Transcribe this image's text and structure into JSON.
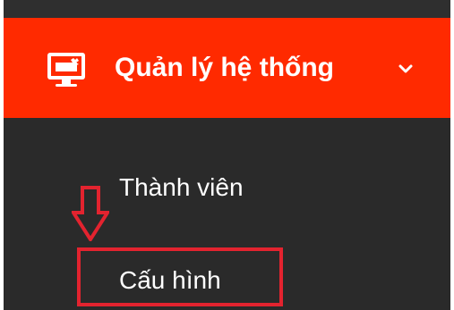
{
  "colors": {
    "header_bg": "#ff2a00",
    "sidebar_bg": "#2a2a2a",
    "text": "#ffffff",
    "annotation": "#e3232f"
  },
  "menu": {
    "header": {
      "label": "Quản lý hệ thống",
      "icon": "monitor-icon",
      "toggle_icon": "chevron-down-icon"
    },
    "items": [
      {
        "label": "Thành viên"
      },
      {
        "label": "Cấu hình",
        "highlighted": true
      }
    ]
  },
  "annotation": {
    "arrow_icon": "down-arrow-icon",
    "box": "highlight-box"
  }
}
